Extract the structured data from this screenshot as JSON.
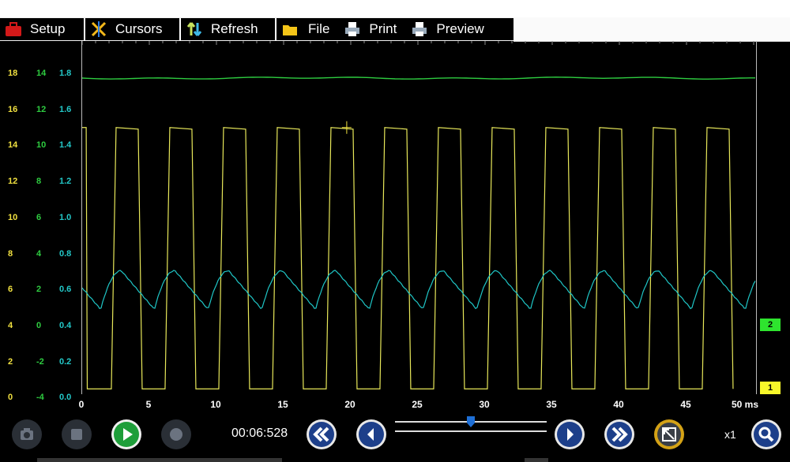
{
  "toolbar": {
    "setup_label": "Setup",
    "cursors_label": "Cursors",
    "refresh_label": "Refresh",
    "file_label": "File",
    "print_label": "Print",
    "preview_label": "Preview"
  },
  "scales": {
    "left_yellow": [
      "18",
      "16",
      "14",
      "12",
      "10",
      "8",
      "6",
      "4",
      "2",
      "0"
    ],
    "left_green": [
      "14",
      "12",
      "10",
      "8",
      "6",
      "4",
      "2",
      "0",
      "-2",
      "-4"
    ],
    "left_cyan": [
      "1.8",
      "1.6",
      "1.4",
      "1.2",
      "1.0",
      "0.8",
      "0.6",
      "0.4",
      "0.2",
      "0.0"
    ]
  },
  "markers": {
    "channel2": "2",
    "channel1": "1"
  },
  "chart_data": {
    "type": "line",
    "x_unit": "ms",
    "x_tick_labels": [
      "0",
      "5",
      "10",
      "15",
      "20",
      "25",
      "30",
      "35",
      "40",
      "45",
      "50 ms"
    ],
    "xlim": [
      0,
      50
    ],
    "series": [
      {
        "color": "#2ecc40",
        "shape": "flat",
        "level_on_cyan_scale": 1.79
      },
      {
        "color": "#e8e85a",
        "shape": "square",
        "period_ms": 4.0,
        "high_on_cyan_scale": 1.51,
        "low_on_cyan_scale": 0.03
      },
      {
        "color": "#1fc6c6",
        "shape": "sawtooth",
        "period_ms": 4.0,
        "min_on_cyan_scale": 0.48,
        "max_on_cyan_scale": 0.7
      }
    ],
    "colors": {
      "yellow": "#f0e040",
      "green": "#2ecc40",
      "cyan": "#23c8c8"
    }
  },
  "playback": {
    "time": "00:06:528",
    "zoom": "x1"
  }
}
